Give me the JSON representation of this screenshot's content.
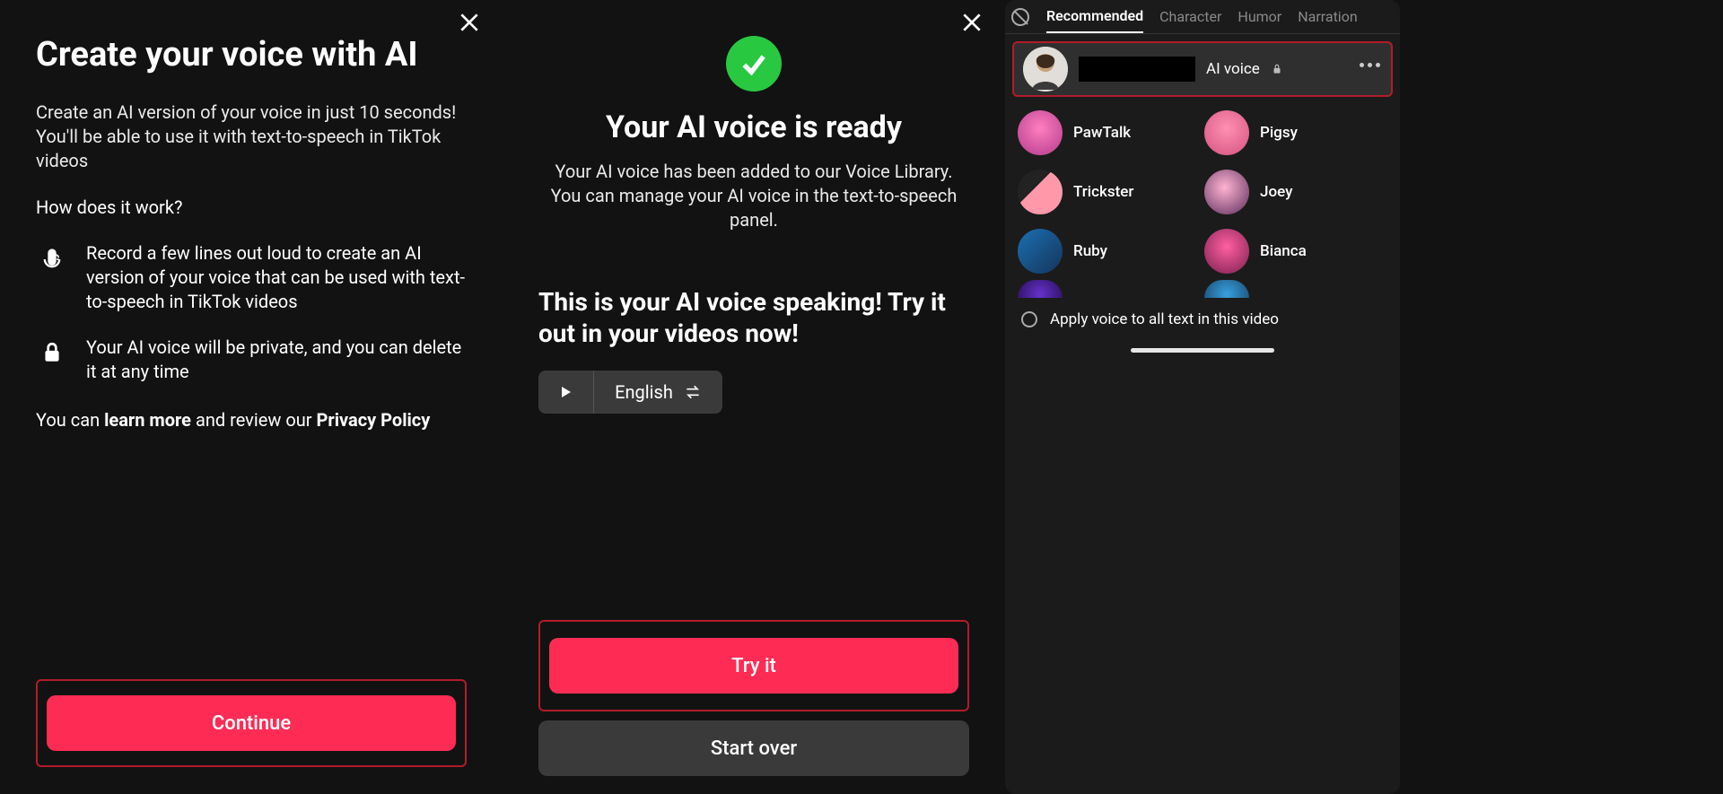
{
  "panel1": {
    "title": "Create your voice with AI",
    "description": "Create an AI version of your voice in just 10 seconds! You'll be able to use it with text-to-speech in TikTok videos",
    "how": "How does it work?",
    "step_record": "Record a few lines out loud to create an AI version of your voice that can be used with text-to-speech in TikTok videos",
    "step_private": "Your AI voice will be private, and you can delete it at any time",
    "policy_prefix": "You can ",
    "policy_learn": "learn more",
    "policy_middle": " and review our ",
    "policy_privacy": "Privacy Policy",
    "continue_label": "Continue"
  },
  "panel2": {
    "title": "Your AI voice is ready",
    "description": "Your AI voice has been added to our Voice Library. You can manage your AI voice in the text-to-speech panel.",
    "speaking": "This is your AI voice speaking! Try it out in your videos now!",
    "language": "English",
    "try_label": "Try it",
    "startover_label": "Start over"
  },
  "panel3": {
    "tabs": {
      "recommended": "Recommended",
      "character": "Character",
      "humor": "Humor",
      "narration": "Narration"
    },
    "user_voice_label": "AI voice",
    "voices": {
      "paw": "PawTalk",
      "pig": "Pigsy",
      "trick": "Trickster",
      "joey": "Joey",
      "ruby": "Ruby",
      "bianca": "Bianca"
    },
    "apply_label": "Apply voice to all text in this video"
  }
}
